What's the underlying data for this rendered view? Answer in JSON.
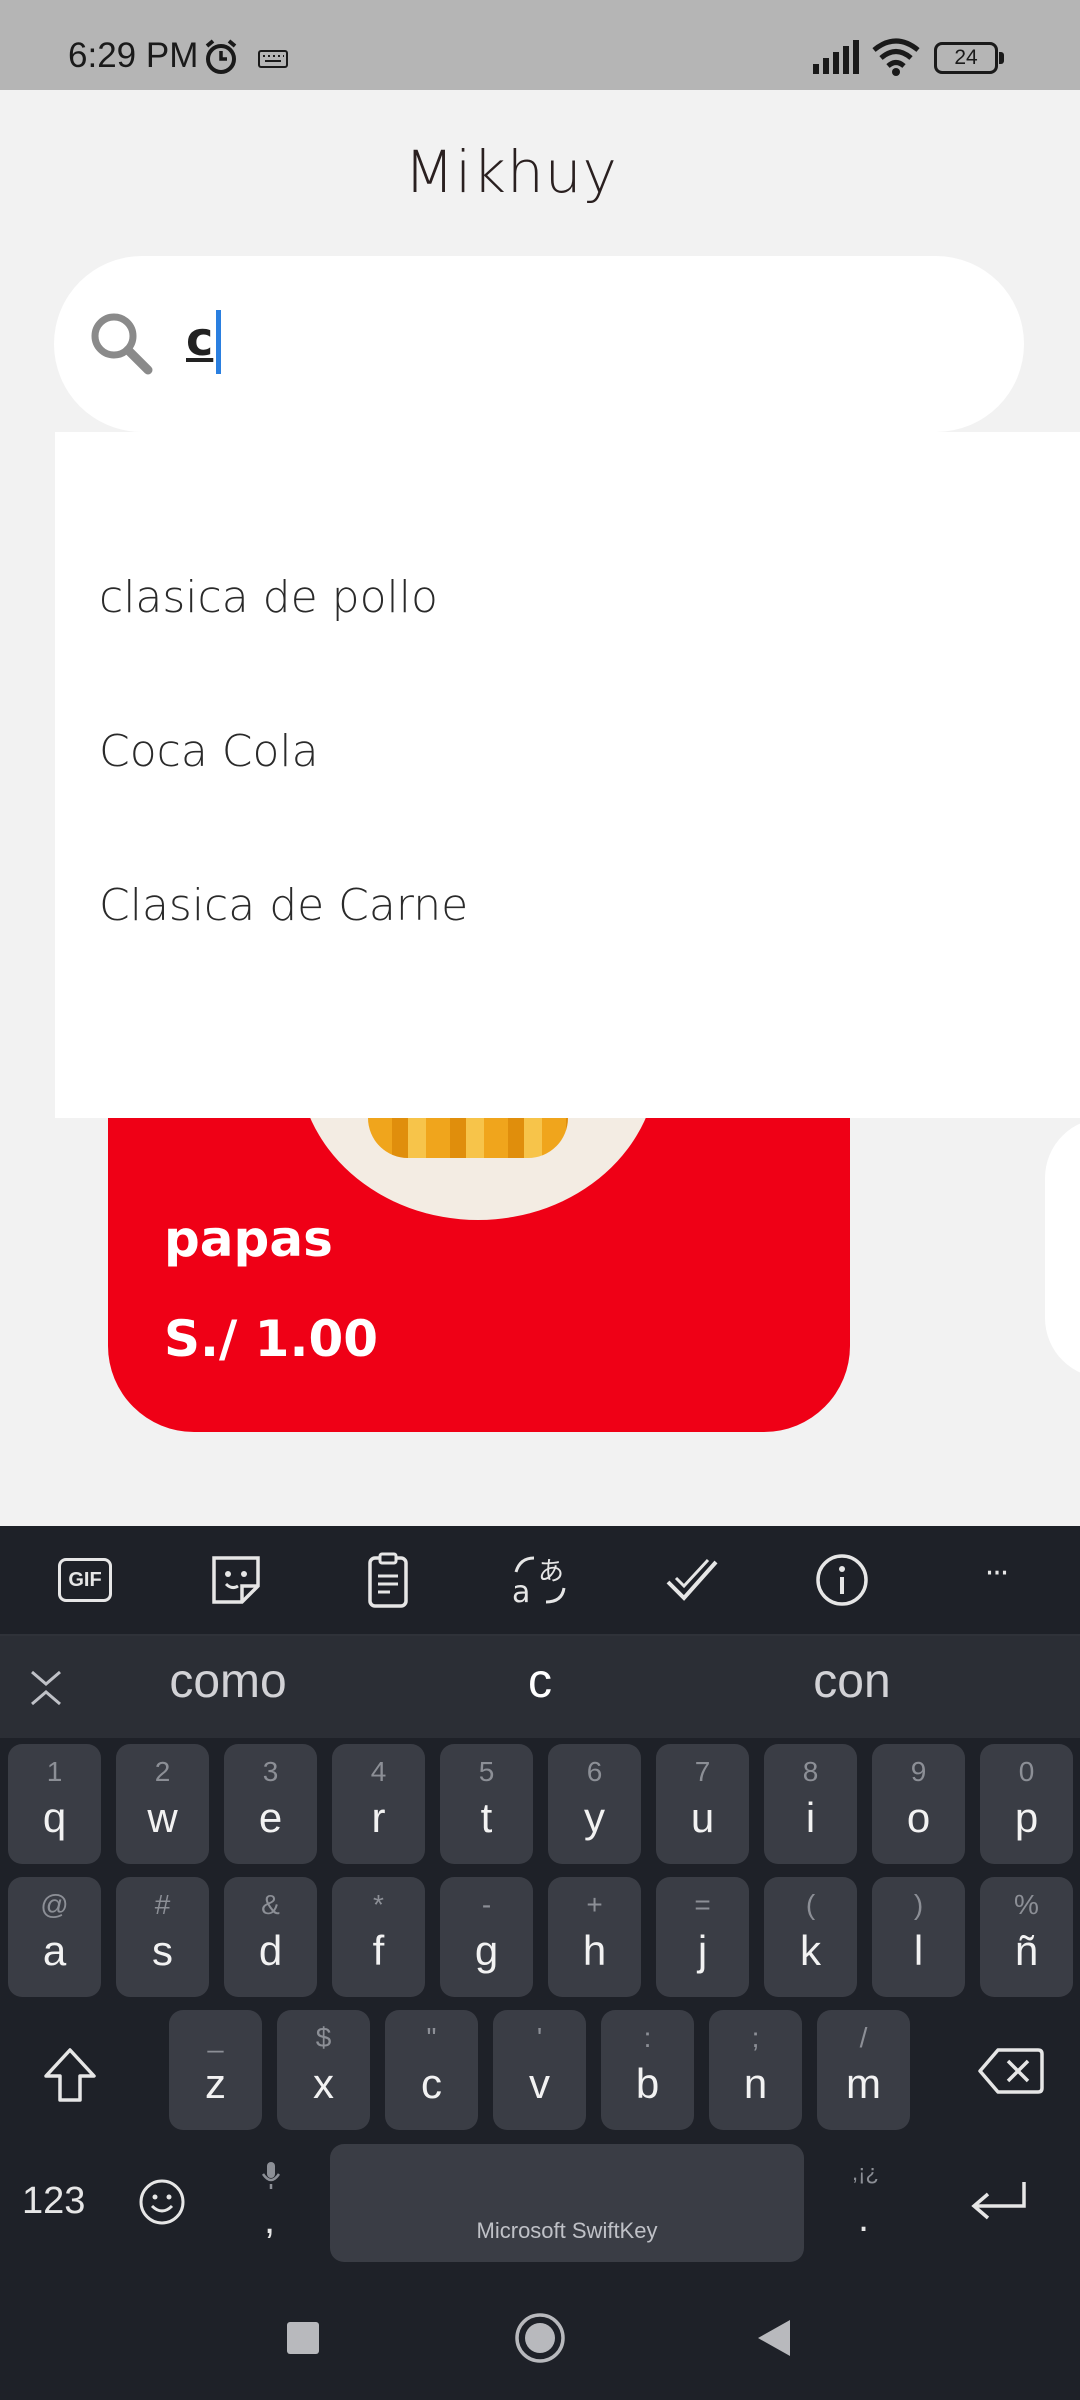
{
  "status_bar": {
    "time": "6:29 PM",
    "battery": "24",
    "icons": [
      "alarm-icon",
      "keyboard-icon",
      "signal-icon",
      "wifi-icon",
      "battery-icon"
    ]
  },
  "app": {
    "title": "Mikhuy",
    "search": {
      "value": "c"
    },
    "suggestions": [
      "clasica de pollo",
      "Coca Cola",
      "Clasica de Carne"
    ],
    "product": {
      "name": "papas",
      "price": "S./ 1.00"
    },
    "accent_color": "#ef0016"
  },
  "keyboard": {
    "toolbar_icons": [
      "gif-icon",
      "sticker-icon",
      "clipboard-icon",
      "translate-icon",
      "checkmark-icon",
      "info-icon",
      "more-icon"
    ],
    "gif_label": "GIF",
    "more_label": "···",
    "suggestions": [
      "como",
      "c",
      "con"
    ],
    "rows": [
      [
        {
          "k": "q",
          "s": "1"
        },
        {
          "k": "w",
          "s": "2"
        },
        {
          "k": "e",
          "s": "3"
        },
        {
          "k": "r",
          "s": "4"
        },
        {
          "k": "t",
          "s": "5"
        },
        {
          "k": "y",
          "s": "6"
        },
        {
          "k": "u",
          "s": "7"
        },
        {
          "k": "i",
          "s": "8"
        },
        {
          "k": "o",
          "s": "9"
        },
        {
          "k": "p",
          "s": "0"
        }
      ],
      [
        {
          "k": "a",
          "s": "@"
        },
        {
          "k": "s",
          "s": "#"
        },
        {
          "k": "d",
          "s": "&"
        },
        {
          "k": "f",
          "s": "*"
        },
        {
          "k": "g",
          "s": "-"
        },
        {
          "k": "h",
          "s": "+"
        },
        {
          "k": "j",
          "s": "="
        },
        {
          "k": "k",
          "s": "("
        },
        {
          "k": "l",
          "s": ")"
        },
        {
          "k": "ñ",
          "s": "%"
        }
      ],
      [
        {
          "k": "z",
          "s": "_"
        },
        {
          "k": "x",
          "s": "$"
        },
        {
          "k": "c",
          "s": "\""
        },
        {
          "k": "v",
          "s": "'"
        },
        {
          "k": "b",
          "s": ":"
        },
        {
          "k": "n",
          "s": ";"
        },
        {
          "k": "m",
          "s": "/"
        }
      ]
    ],
    "num_label": "123",
    "comma_label": ",",
    "period_label": ".",
    "period_secondary": ",¡¿",
    "space_label": "Microsoft SwiftKey"
  }
}
